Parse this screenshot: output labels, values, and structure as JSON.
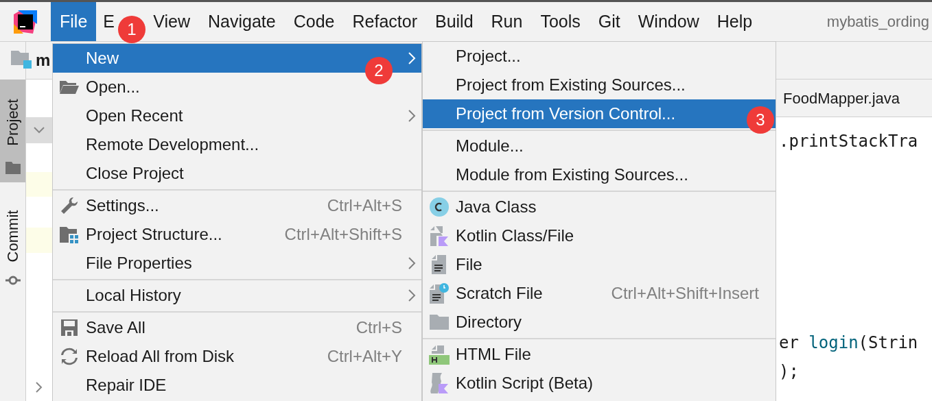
{
  "menu_bar": [
    {
      "label": "File",
      "selected": true
    },
    {
      "label": "E",
      "selected": false
    },
    {
      "label": "View",
      "selected": false
    },
    {
      "label": "Navigate",
      "selected": false
    },
    {
      "label": "Code",
      "selected": false
    },
    {
      "label": "Refactor",
      "selected": false
    },
    {
      "label": "Build",
      "selected": false
    },
    {
      "label": "Run",
      "selected": false
    },
    {
      "label": "Tools",
      "selected": false
    },
    {
      "label": "Git",
      "selected": false
    },
    {
      "label": "Window",
      "selected": false
    },
    {
      "label": "Help",
      "selected": false
    }
  ],
  "window_title": "mybatis_ording",
  "toolbar": {
    "project_name": "m"
  },
  "side_tabs": [
    {
      "label": "Project",
      "selected": true
    },
    {
      "label": "Commit",
      "selected": false
    }
  ],
  "editor": {
    "tab": "FoodMapper.java",
    "code_lines": [
      {
        "kind": "plain",
        "text": ".printStackTra"
      },
      {
        "kind": "blank"
      },
      {
        "kind": "blank"
      },
      {
        "kind": "blank"
      },
      {
        "kind": "blank"
      },
      {
        "kind": "blank"
      },
      {
        "kind": "blank"
      },
      {
        "kind": "call",
        "text": "er ",
        "method": "login",
        "rest": "(Strin"
      },
      {
        "kind": "plain",
        "text": ");"
      }
    ]
  },
  "file_menu": [
    {
      "kind": "item",
      "label": "New",
      "submenu": true,
      "selected": true
    },
    {
      "kind": "item",
      "label": "Open...",
      "submenu": false,
      "selected": false
    },
    {
      "kind": "item",
      "label": "Open Recent",
      "submenu": true,
      "selected": false
    },
    {
      "kind": "item",
      "label": "Remote Development...",
      "submenu": false,
      "selected": false
    },
    {
      "kind": "item",
      "label": "Close Project",
      "submenu": false,
      "selected": false
    },
    {
      "kind": "separator"
    },
    {
      "kind": "item",
      "label": "Settings...",
      "shortcut": "Ctrl+Alt+S",
      "submenu": false,
      "selected": false
    },
    {
      "kind": "item",
      "label": "Project Structure...",
      "shortcut": "Ctrl+Alt+Shift+S",
      "submenu": false,
      "selected": false
    },
    {
      "kind": "item",
      "label": "File Properties",
      "submenu": true,
      "selected": false
    },
    {
      "kind": "separator"
    },
    {
      "kind": "item",
      "label": "Local History",
      "submenu": true,
      "selected": false
    },
    {
      "kind": "separator"
    },
    {
      "kind": "item",
      "label": "Save All",
      "shortcut": "Ctrl+S",
      "submenu": false,
      "selected": false
    },
    {
      "kind": "item",
      "label": "Reload All from Disk",
      "shortcut": "Ctrl+Alt+Y",
      "submenu": false,
      "selected": false
    },
    {
      "kind": "item",
      "label": "Repair IDE",
      "submenu": false,
      "selected": false
    }
  ],
  "new_submenu": [
    {
      "kind": "item",
      "label": "Project...",
      "selected": false
    },
    {
      "kind": "item",
      "label": "Project from Existing Sources...",
      "selected": false
    },
    {
      "kind": "item",
      "label": "Project from Version Control...",
      "selected": true
    },
    {
      "kind": "separator"
    },
    {
      "kind": "item",
      "label": "Module...",
      "selected": false
    },
    {
      "kind": "item",
      "label": "Module from Existing Sources...",
      "selected": false
    },
    {
      "kind": "separator"
    },
    {
      "kind": "item",
      "label": "Java Class",
      "selected": false
    },
    {
      "kind": "item",
      "label": "Kotlin Class/File",
      "selected": false
    },
    {
      "kind": "item",
      "label": "File",
      "selected": false
    },
    {
      "kind": "item",
      "label": "Scratch File",
      "shortcut": "Ctrl+Alt+Shift+Insert",
      "selected": false
    },
    {
      "kind": "item",
      "label": "Directory",
      "selected": false
    },
    {
      "kind": "separator"
    },
    {
      "kind": "item",
      "label": "HTML File",
      "selected": false
    },
    {
      "kind": "item",
      "label": "Kotlin Script (Beta)",
      "selected": false
    }
  ],
  "annotations": [
    {
      "text": "1"
    },
    {
      "text": "2"
    },
    {
      "text": "3"
    }
  ]
}
